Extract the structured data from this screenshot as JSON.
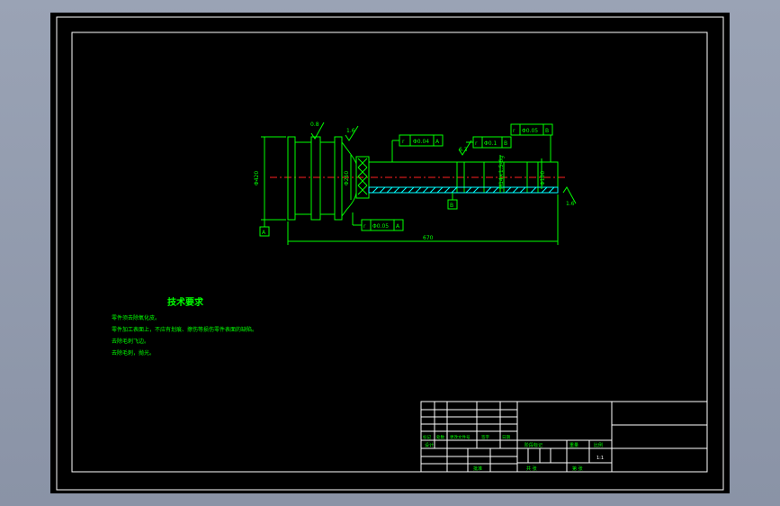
{
  "drawing": {
    "overall_length_dim": "670",
    "left_diameter_dim": "Φ420",
    "flange_diameter_dim": "Φ260",
    "bore_dim": "Φ100",
    "thread_dim": "M14×1.5-6g",
    "roughness_left": "0.8",
    "roughness_mid": "1.6",
    "roughness_right": "1.6",
    "roughness_shaft": "6.3",
    "datum_a": "A",
    "datum_b": "B",
    "fcf_top_sym": "r",
    "fcf_top_val": "Φ0.04",
    "fcf_top_ref": "A",
    "fcf_mid_sym": "r",
    "fcf_mid_val": "Φ0.1",
    "fcf_mid_ref": "B",
    "fcf_right_sym": "r",
    "fcf_right_val": "Φ0.05",
    "fcf_right_ref": "B",
    "fcf_bottom_sym": "r",
    "fcf_bottom_val": "Φ0.05",
    "fcf_bottom_ref": "A"
  },
  "tech_requirements": {
    "title": "技术要求",
    "items": [
      "零件须去除氧化皮。",
      "零件加工表面上，不应有划痕、擦伤等损伤零件表面的缺陷。",
      "去除毛刺飞边。",
      "去除毛刺，抛光。"
    ]
  },
  "title_block": {
    "row_labels": [
      "标记",
      "处数",
      "更改文件号",
      "签字",
      "日期"
    ],
    "design_label": "设计",
    "stage_label": "阶段标记",
    "weight_label": "重量",
    "ratio_label": "比例",
    "scale": "1:1",
    "approve_label": "批准",
    "sheet_total_label": "共  张",
    "sheet_label": "第  张"
  },
  "colors": {
    "background": "#000000",
    "frame": "#ffffff",
    "geometry": "#00ff00",
    "centerline": "#ff2020",
    "hatch": "#00ffff"
  }
}
